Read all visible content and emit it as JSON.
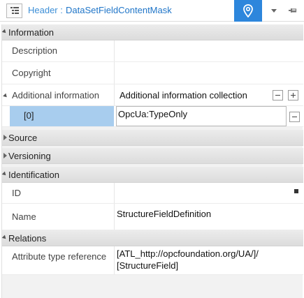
{
  "header": {
    "label": "Header :",
    "value": "DataSetFieldContentMask",
    "accent_color": "#2d86dc",
    "icons": [
      "properties-icon",
      "pin-location-icon",
      "dropdown-arrow-icon",
      "unpin-icon"
    ]
  },
  "sections": {
    "information": "Information",
    "source": "Source",
    "versioning": "Versioning",
    "identification": "Identification",
    "relations": "Relations"
  },
  "information": {
    "description": {
      "name": "Description",
      "value": ""
    },
    "copyright": {
      "name": "Copyright",
      "value": ""
    },
    "additional": {
      "name": "Additional information",
      "value": "Additional information collection"
    },
    "additional_item": {
      "index": "[0]",
      "value": "OpcUa:TypeOnly"
    }
  },
  "identification": {
    "id": {
      "name": "ID",
      "value": ""
    },
    "name": {
      "name": "Name",
      "value": "StructureFieldDefinition"
    }
  },
  "relations": {
    "attribute_type_reference": {
      "name": "Attribute type reference",
      "value_line1": "[ATL_http://opcfoundation.org/UA/]/",
      "value_line2": "[StructureField]"
    }
  },
  "colors": {
    "selected_index": "#a8cdee",
    "section_bg": "#e4e4e4",
    "header_text": "#1f75c8"
  }
}
